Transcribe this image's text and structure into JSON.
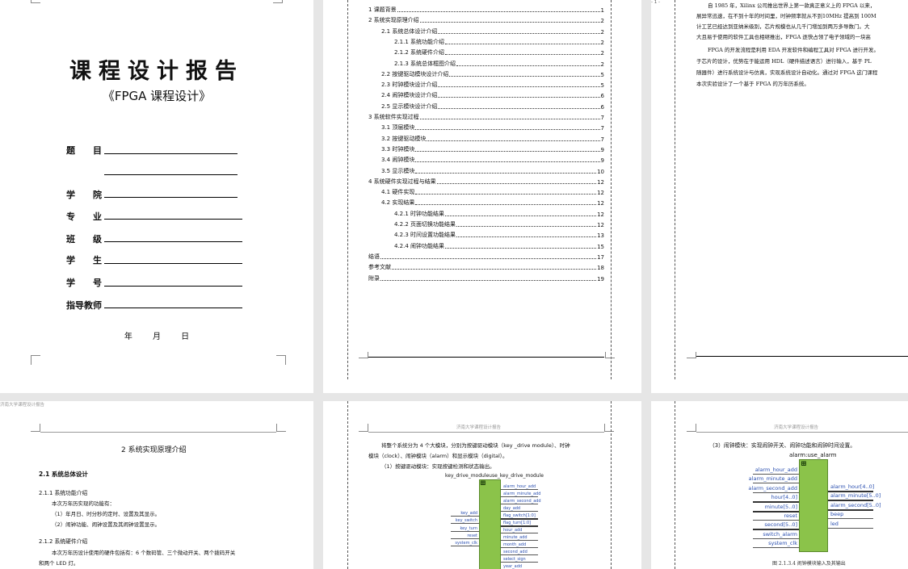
{
  "cover": {
    "title": "课程设计报告",
    "subtitle": "《FPGA 课程设计》",
    "fields": [
      "题　　目",
      "学　　院",
      "专　　业",
      "班　　级",
      "学　　生",
      "学　　号",
      "指导教师"
    ],
    "date": "年 月 日"
  },
  "toc": [
    {
      "title": "1  课题背景",
      "page": "1",
      "level": 0
    },
    {
      "title": "2  系统实现原理介绍",
      "page": "2",
      "level": 0
    },
    {
      "title": "2.1 系统总体设计介绍",
      "page": "2",
      "level": 1
    },
    {
      "title": "2.1.1  系统功能介绍",
      "page": "2",
      "level": 2
    },
    {
      "title": "2.1.2  系统硬件介绍",
      "page": "2",
      "level": 2
    },
    {
      "title": "2.1.3  系统总体框图介绍",
      "page": "2",
      "level": 2
    },
    {
      "title": "2.2 按键驱动模块设计介绍",
      "page": "5",
      "level": 1
    },
    {
      "title": "2.3 时钟模块设计介绍",
      "page": "5",
      "level": 1
    },
    {
      "title": "2.4 闹钟模块设计介绍",
      "page": "6",
      "level": 1
    },
    {
      "title": "2.5 显示模块设计介绍",
      "page": "6",
      "level": 1
    },
    {
      "title": "3  系统软件实现过程",
      "page": "7",
      "level": 0
    },
    {
      "title": "3.1 顶层模块",
      "page": "7",
      "level": 1
    },
    {
      "title": "3.2 按键驱动模块",
      "page": "7",
      "level": 1
    },
    {
      "title": "3.3 时钟模块",
      "page": "9",
      "level": 1
    },
    {
      "title": "3.4 闹钟模块",
      "page": "9",
      "level": 1
    },
    {
      "title": "3.5 显示模块",
      "page": "10",
      "level": 1
    },
    {
      "title": "4 系统硬件实现过程与结果",
      "page": "12",
      "level": 0
    },
    {
      "title": "4.1 硬件实现",
      "page": "12",
      "level": 1
    },
    {
      "title": "4.2 实现结果",
      "page": "12",
      "level": 1
    },
    {
      "title": "4.2.1  时钟功能结果",
      "page": "12",
      "level": 2
    },
    {
      "title": "4.2.2  页面切换功能结果",
      "page": "12",
      "level": 2
    },
    {
      "title": "4.2.3  时间设置功能结果",
      "page": "13",
      "level": 2
    },
    {
      "title": "4.2.4  闹钟功能结果",
      "page": "15",
      "level": 2
    },
    {
      "title": "结语",
      "page": "17",
      "level": -1
    },
    {
      "title": "参考文献",
      "page": "18",
      "level": -1
    },
    {
      "title": "附录",
      "page": "19",
      "level": -1
    }
  ],
  "page3": {
    "lines": [
      "自 1985 年，Xilinx 公司推出世界上第一款真正意义上的 FPGA 以来，",
      "展异常迅速，在不到十年的时间里，时钟频率就从不到10MHz 提高到 100M",
      "计工艺已经达到亚纳米级别，芯片规模也从几千门增加到两万多导数门。大",
      "大且易于使用的软件工具也相继推出，FPGA 逐快占领了电子领域的一块高",
      "FPGA 的开发流程是利用 EDA 开发软件和编程工具对 FPGA 进行开发。",
      "于芯片的设计，优势在于能运用 HDL（硬件描述语言）进行输入，基于 PL",
      "随器件）进行系统设计与仿真，实现系统设计自动化。通过对 FPGA 这门课程",
      "本次实验设计了一个基于 FPGA 的万年历系统。"
    ],
    "page_number": "- 1 -"
  },
  "page4": {
    "header": "济南大学课程设计报告",
    "chapter": "2  系统实现原理介绍",
    "s21": "2.1  系统总体设计",
    "s211": "2.1.1  系统功能介绍",
    "l1": "本次万年历实现的功能有：",
    "l2": "（1）年月日、时分秒的定时、设置及其显示。",
    "l3": "（2）闹钟功能、闹钟设置及其闹钟设置显示。",
    "s212": "2.1.2  系统硬件介绍",
    "l4": "本次万年历设计使用的硬件包括有：6 个数码管、三个微动开关、两个拨码开关",
    "l5": "和两个 LED 灯。"
  },
  "page5": {
    "header": "济南大学课程设计报告",
    "l1": "将整个系统分为 4 个大模块，分别为按键驱动模块（key _drive module）、时钟",
    "l2": "模块（clock）、闹钟模块（alarm）和显示模块（digital）。",
    "l3": "（1）按键驱动模块：实现按键检测和状态输出。",
    "module_title": "key_drive_moduleuse_key_drive_module",
    "inputs": [
      "key_add",
      "key_switch",
      "key_turn",
      "reset",
      "system_clk"
    ],
    "outputs": [
      "alarm_hour_add",
      "alarm_minute_add",
      "alarm_second_add",
      "day_add",
      "flag_switch[1:0]",
      "flag_turn[1:0]",
      "hour_add",
      "minute_add",
      "month_add",
      "second_add",
      "select_sign",
      "year_add"
    ]
  },
  "page6": {
    "header": "济南大学课程设计报告",
    "l1": "（3）闹钟模块：实现闹钟开关、闹钟功能和闹钟时间设置。",
    "module_title": "alarm:use_alarm",
    "inputs": [
      "alarm_hour_add",
      "alarm_minute_add",
      "alarm_second_add",
      "hour[4..0]",
      "minute[5..0]",
      "reset",
      "second[5..0]",
      "switch_alarm",
      "system_clk"
    ],
    "outputs": [
      "alarm_hour[4..0]",
      "alarm_minute[5..0]",
      "alarm_second[5..0]",
      "beep",
      "led"
    ],
    "caption": "图 2.1.3.4  闹钟模块输入及其输出"
  }
}
